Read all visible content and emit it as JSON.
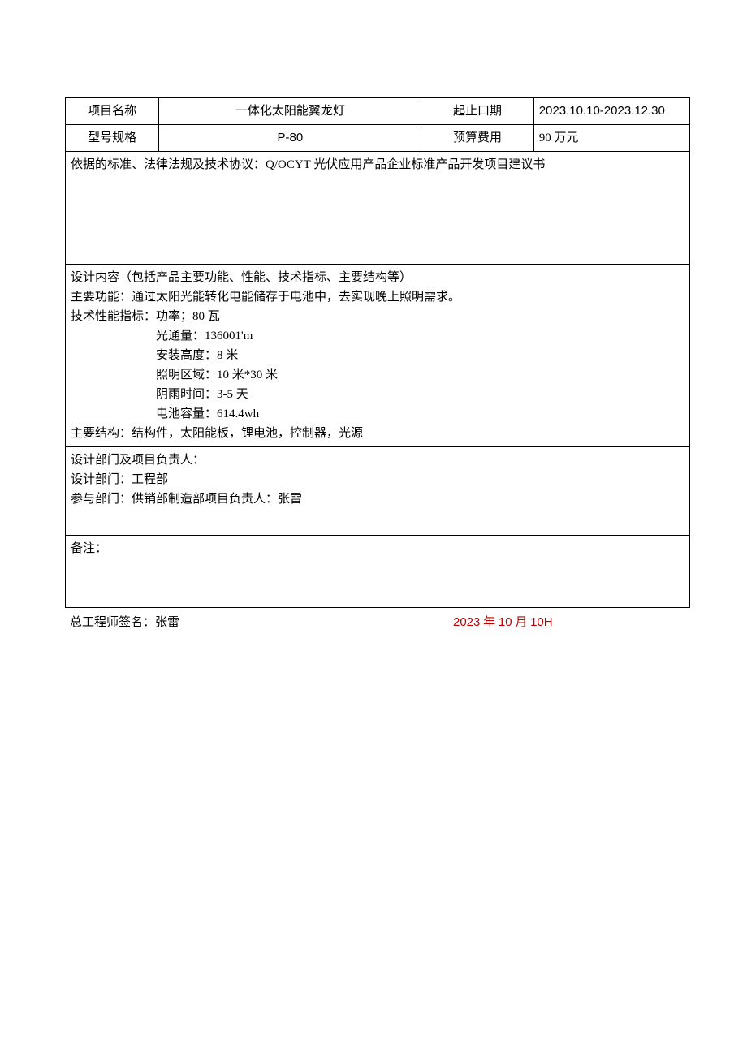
{
  "row1": {
    "label_name": "项目名称",
    "value_name": "一体化太阳能翼龙灯",
    "label_period": "起止口期",
    "value_period": "2023.10.10-2023.12.30"
  },
  "row2": {
    "label_model": "型号规格",
    "value_model": "P-80",
    "label_budget": "预算费用",
    "value_budget": "90 万元"
  },
  "basis": {
    "text": "依据的标准、法律法规及技术协议：Q/OCYT 光伏应用产品企业标准产品开发项目建议书"
  },
  "design": {
    "heading": "设计内容（包括产品主要功能、性能、技术指标、主要结构等）",
    "main_function": "主要功能：通过太阳光能转化电能储存于电池中，去实现晚上照明需求。",
    "tech_label": "技术性能指标：功率；80 瓦",
    "specs": {
      "flux": "光通量：136001'm",
      "height": "安装高度：8 米",
      "area": "照明区域：10 米*30 米",
      "rain": "阴雨时间：3-5 天",
      "battery": "电池容量：614.4wh"
    },
    "structure": "主要结构：结构件，太阳能板，锂电池，控制器，光源"
  },
  "dept": {
    "heading": "设计部门及项目负责人：",
    "design_dept": "设计部门：工程部",
    "participants": "参与部门：供销部制造部项目负责人：张雷"
  },
  "remark": {
    "label": "备注："
  },
  "footer": {
    "signature": "总工程师签名：张雷",
    "date_prefix": "2023",
    "date_mid": " 年 ",
    "date_month": "10",
    "date_suffix1": " 月 ",
    "date_day": "10H"
  }
}
